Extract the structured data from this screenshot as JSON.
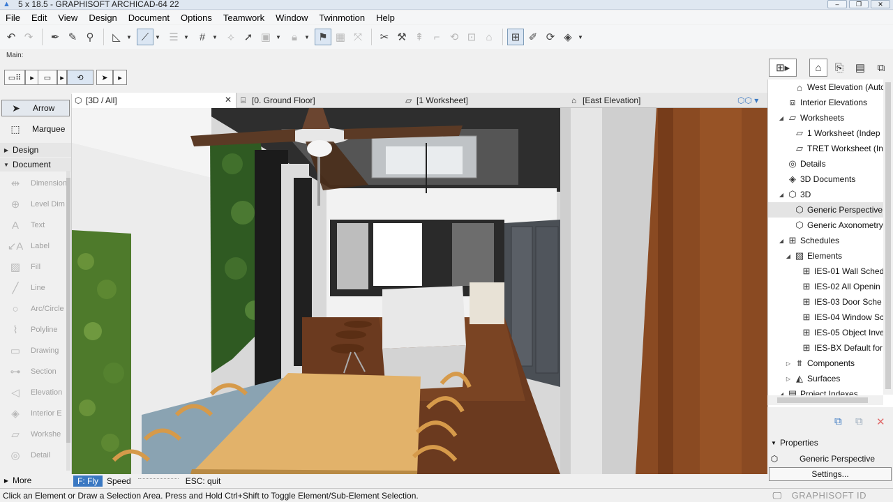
{
  "window": {
    "title": "5 x 18.5 - GRAPHISOFT ARCHICAD-64 22",
    "controls": [
      "minimize",
      "restore",
      "close"
    ]
  },
  "menu": [
    "File",
    "Edit",
    "View",
    "Design",
    "Document",
    "Options",
    "Teamwork",
    "Window",
    "Twinmotion",
    "Help"
  ],
  "infobox": {
    "label": "Main:"
  },
  "toolbox": {
    "arrow": "Arrow",
    "marquee": "Marquee",
    "groups": {
      "design": "Design",
      "document": "Document"
    },
    "document_tools": [
      "Dimension",
      "Level Dim",
      "Text",
      "Label",
      "Fill",
      "Line",
      "Arc/Circle",
      "Polyline",
      "Drawing",
      "Section",
      "Elevation",
      "Interior E",
      "Workshe",
      "Detail"
    ],
    "more": "More"
  },
  "tabs": [
    {
      "label": "[3D / All]",
      "icon": "3d-cube-icon",
      "active": true
    },
    {
      "label": "[0. Ground Floor]",
      "icon": "floorplan-icon",
      "active": false
    },
    {
      "label": "[1 Worksheet]",
      "icon": "worksheet-icon",
      "active": false
    },
    {
      "label": "[East Elevation]",
      "icon": "elevation-icon",
      "active": false
    }
  ],
  "navigator": {
    "items": [
      {
        "label": "West Elevation (Auto",
        "icon": "elevation-icon",
        "level": 2,
        "selected": false
      },
      {
        "label": "Interior Elevations",
        "icon": "interior-elevation-icon",
        "level": 1,
        "selected": false
      },
      {
        "label": "Worksheets",
        "icon": "worksheet-icon",
        "level": 1,
        "expanded": true,
        "selected": false
      },
      {
        "label": "1 Worksheet (Indep",
        "icon": "worksheet-icon",
        "level": 2,
        "selected": false
      },
      {
        "label": "TRET Worksheet (In",
        "icon": "worksheet-icon",
        "level": 2,
        "selected": false
      },
      {
        "label": "Details",
        "icon": "detail-icon",
        "level": 1,
        "selected": false
      },
      {
        "label": "3D Documents",
        "icon": "3d-document-icon",
        "level": 1,
        "selected": false
      },
      {
        "label": "3D",
        "icon": "3d-cube-icon",
        "level": 1,
        "expanded": true,
        "selected": false
      },
      {
        "label": "Generic Perspective",
        "icon": "3d-cube-icon",
        "level": 2,
        "selected": true
      },
      {
        "label": "Generic Axonometry",
        "icon": "3d-cube-icon",
        "level": 2,
        "selected": false
      },
      {
        "label": "Schedules",
        "icon": "schedule-icon",
        "level": 1,
        "expanded": true,
        "selected": false
      },
      {
        "label": "Elements",
        "icon": "elements-icon",
        "level": 2,
        "expanded": true,
        "selected": false
      },
      {
        "label": "IES-01 Wall Sched",
        "icon": "schedule-icon",
        "level": 3,
        "selected": false
      },
      {
        "label": "IES-02 All Openin",
        "icon": "schedule-icon",
        "level": 3,
        "selected": false
      },
      {
        "label": "IES-03 Door Sche",
        "icon": "schedule-icon",
        "level": 3,
        "selected": false
      },
      {
        "label": "IES-04 Window Sc",
        "icon": "schedule-icon",
        "level": 3,
        "selected": false
      },
      {
        "label": "IES-05 Object Inve",
        "icon": "schedule-icon",
        "level": 3,
        "selected": false
      },
      {
        "label": "IES-BX Default for",
        "icon": "schedule-icon",
        "level": 3,
        "selected": false
      },
      {
        "label": "Components",
        "icon": "components-icon",
        "level": 2,
        "collapsed": true,
        "selected": false
      },
      {
        "label": "Surfaces",
        "icon": "surfaces-icon",
        "level": 2,
        "collapsed": true,
        "selected": false
      },
      {
        "label": "Project Indexes",
        "icon": "index-icon",
        "level": 1,
        "selected": false
      }
    ]
  },
  "properties": {
    "header": "Properties",
    "name": "Generic Perspective",
    "settings": "Settings..."
  },
  "fly": {
    "mode": "F: Fly",
    "speed": "Speed",
    "esc": "ESC: quit"
  },
  "status": {
    "message": "Click an Element or Draw a Selection Area. Press and Hold Ctrl+Shift to Toggle Element/Sub-Element Selection.",
    "brand": "GRAPHISOFT ID"
  },
  "colors": {
    "accent": "#3a78c2",
    "wood_floor": "#6b3a1f",
    "wood_panel": "#9b5a2c",
    "table": "#e2b26a"
  }
}
